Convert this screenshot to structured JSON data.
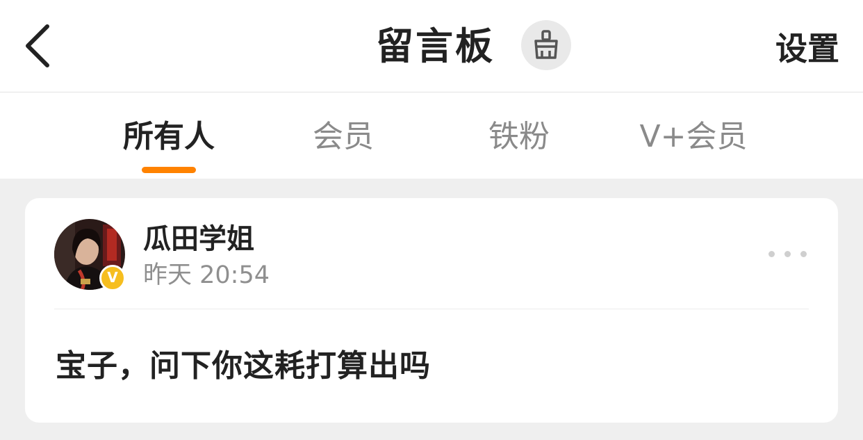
{
  "header": {
    "title": "留言板",
    "settings_label": "设置",
    "back_icon": "chevron-left-icon",
    "clean_icon": "broom-icon"
  },
  "tabs": [
    {
      "label": "所有人",
      "active": true
    },
    {
      "label": "会员",
      "active": false
    },
    {
      "label": "铁粉",
      "active": false
    },
    {
      "label": "V+会员",
      "active": false
    }
  ],
  "message": {
    "author": "瓜田学姐",
    "time": "昨天 20:54",
    "verified_badge": "V",
    "text": "宝子，问下你这耗打算出吗",
    "more_icon": "more-dots-icon"
  },
  "colors": {
    "accent": "#ff8200",
    "badge": "#f6be1f",
    "background": "#efefef"
  }
}
